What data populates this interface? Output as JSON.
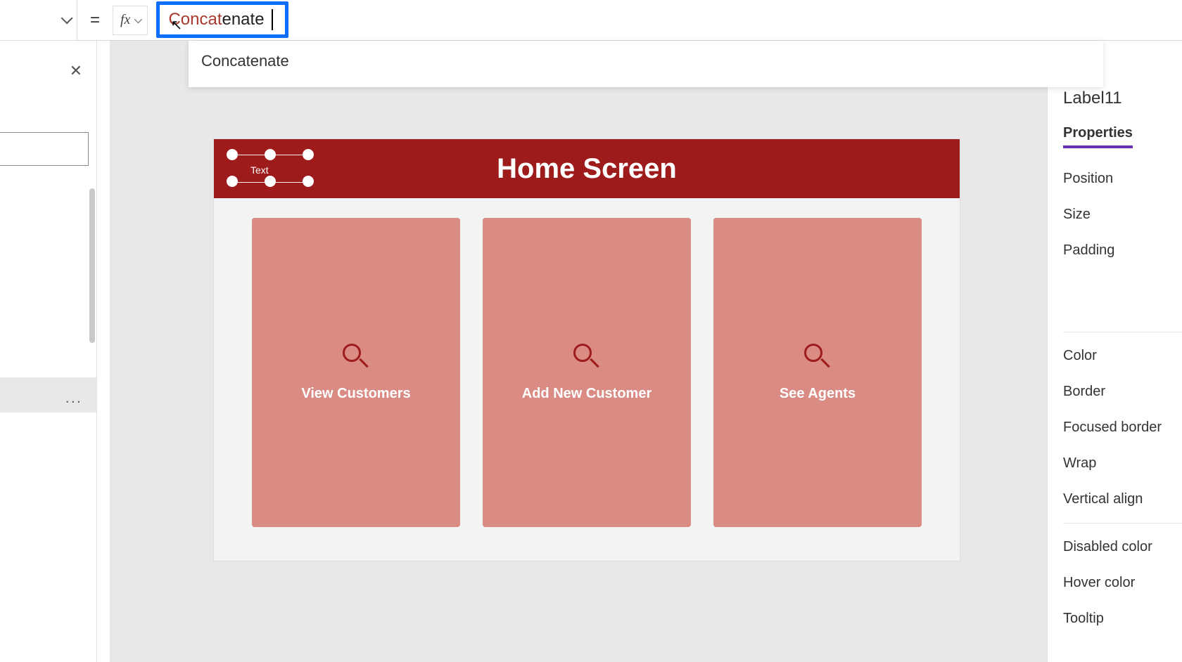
{
  "formula": {
    "equals": "=",
    "fx": "fx",
    "typed_part": "Concat",
    "rest_part": "enate"
  },
  "suggestion": {
    "label": "Concatenate"
  },
  "selected_label_text": "Text",
  "screen": {
    "title": "Home Screen",
    "tiles": [
      {
        "label": "View Customers"
      },
      {
        "label": "Add New Customer"
      },
      {
        "label": "See Agents"
      }
    ]
  },
  "right": {
    "control_name": "Label11",
    "tab": "Properties",
    "props": [
      "Position",
      "Size",
      "Padding",
      "Color",
      "Border",
      "Focused border",
      "Wrap",
      "Vertical align",
      "Disabled color",
      "Hover color",
      "Tooltip"
    ]
  },
  "dots": "..."
}
